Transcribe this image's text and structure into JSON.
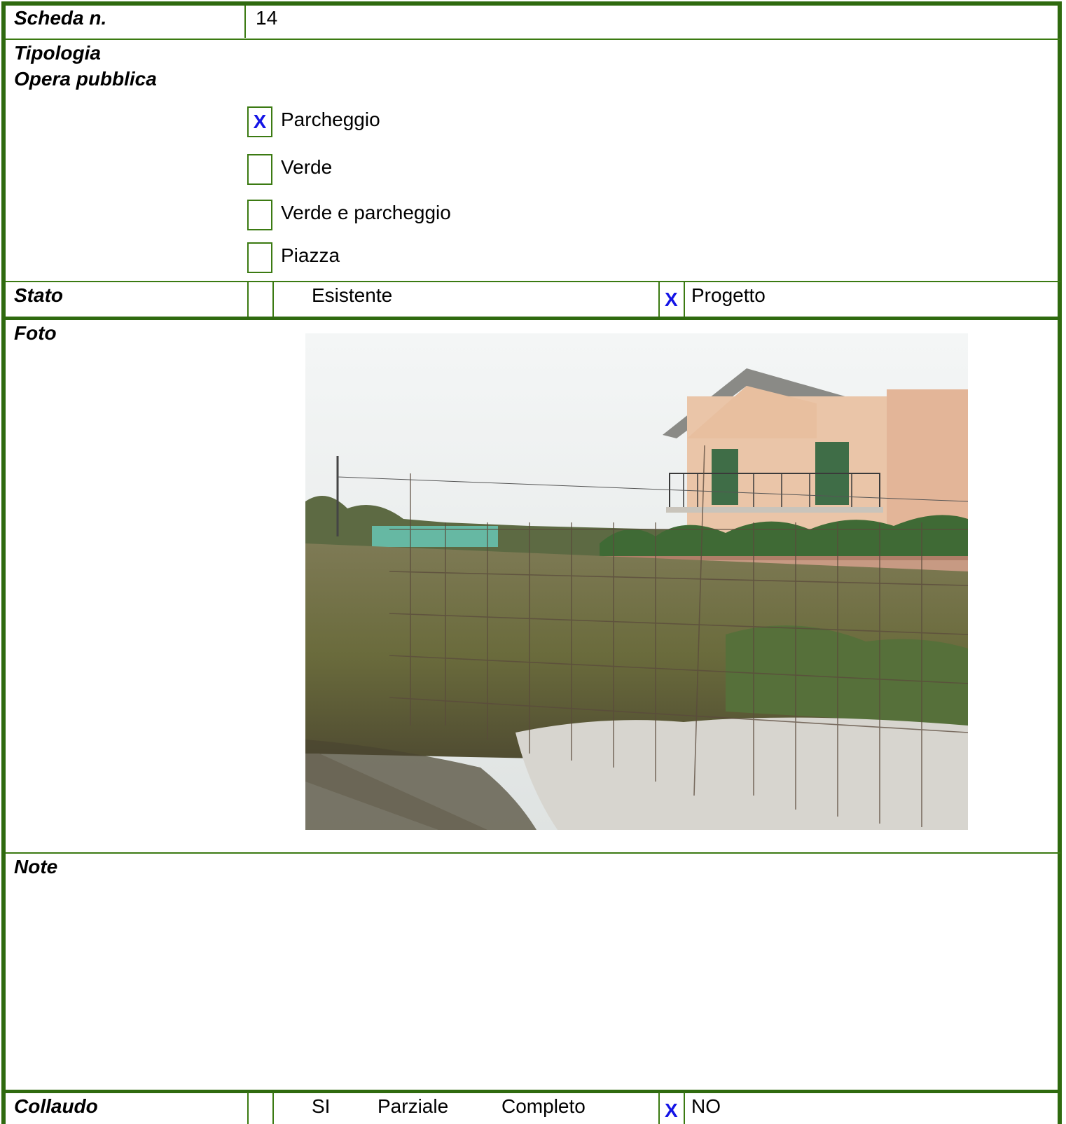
{
  "scheda": {
    "label": "Scheda n.",
    "value": "14"
  },
  "tipologia": {
    "label_line1": "Tipologia",
    "label_line2": "Opera pubblica",
    "options": [
      {
        "label": "Parcheggio",
        "mark": "X"
      },
      {
        "label": "Verde",
        "mark": ""
      },
      {
        "label": "Verde e parcheggio",
        "mark": ""
      },
      {
        "label": "Piazza",
        "mark": ""
      }
    ]
  },
  "stato": {
    "label": "Stato",
    "option1": "Esistente",
    "option1_mark": "",
    "option2": "Progetto",
    "option2_mark": "X"
  },
  "foto": {
    "label": "Foto"
  },
  "note": {
    "label": "Note"
  },
  "collaudo": {
    "label": "Collaudo",
    "si": "SI",
    "parziale": "Parziale",
    "completo": "Completo",
    "si_mark": "",
    "no": "NO",
    "no_mark": "X"
  },
  "colors": {
    "border": "#2f6a0f",
    "check": "#1414e6"
  }
}
